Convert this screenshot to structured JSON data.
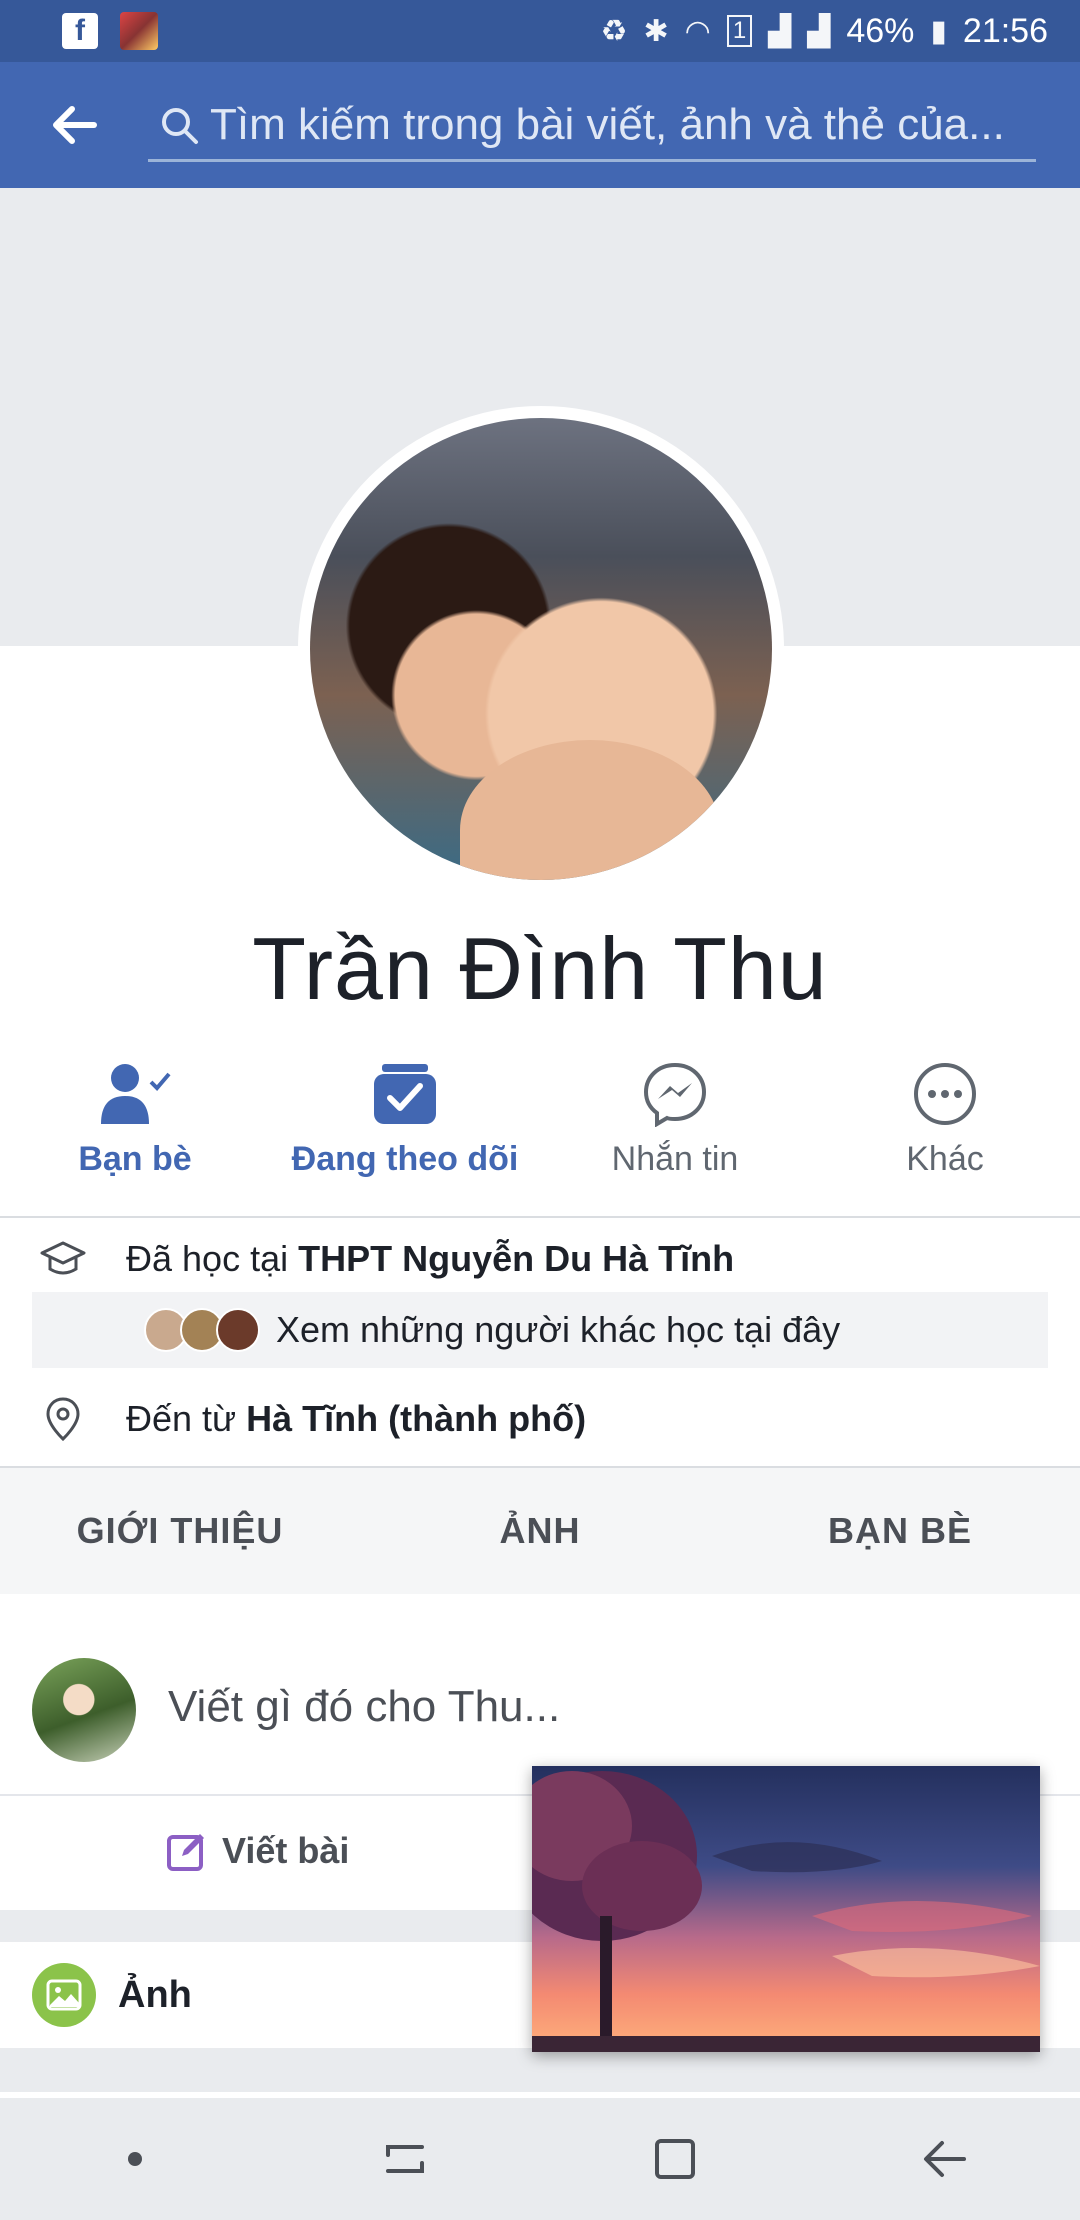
{
  "status_bar": {
    "battery": "46%",
    "time": "21:56",
    "sim_badge": "1"
  },
  "search": {
    "placeholder": "Tìm kiếm trong bài viết, ảnh và thẻ của..."
  },
  "profile": {
    "name": "Trần Đình Thu"
  },
  "actions": [
    {
      "label": "Bạn bè",
      "icon": "friends-check-icon"
    },
    {
      "label": "Đang theo dõi",
      "icon": "following-check-icon"
    },
    {
      "label": "Nhắn tin",
      "icon": "messenger-icon"
    },
    {
      "label": "Khác",
      "icon": "more-dots-icon"
    }
  ],
  "info": {
    "education_prefix": "Đã học tại ",
    "education_place": "THPT Nguyễn Du Hà Tĩnh",
    "others_text": "Xem những người khác học tại đây",
    "hometown_prefix": "Đến từ ",
    "hometown_place": "Hà Tĩnh (thành phố)"
  },
  "tabs": [
    {
      "label": "GIỚI THIỆU"
    },
    {
      "label": "ẢNH"
    },
    {
      "label": "BẠN BÈ"
    }
  ],
  "composer": {
    "prompt": "Viết gì đó cho Thu...",
    "write_label": "Viết bài"
  },
  "photos": {
    "label": "Ảnh"
  },
  "colors": {
    "brand": "#4267b2",
    "status_bar": "#365899",
    "background": "#e9ebee"
  }
}
